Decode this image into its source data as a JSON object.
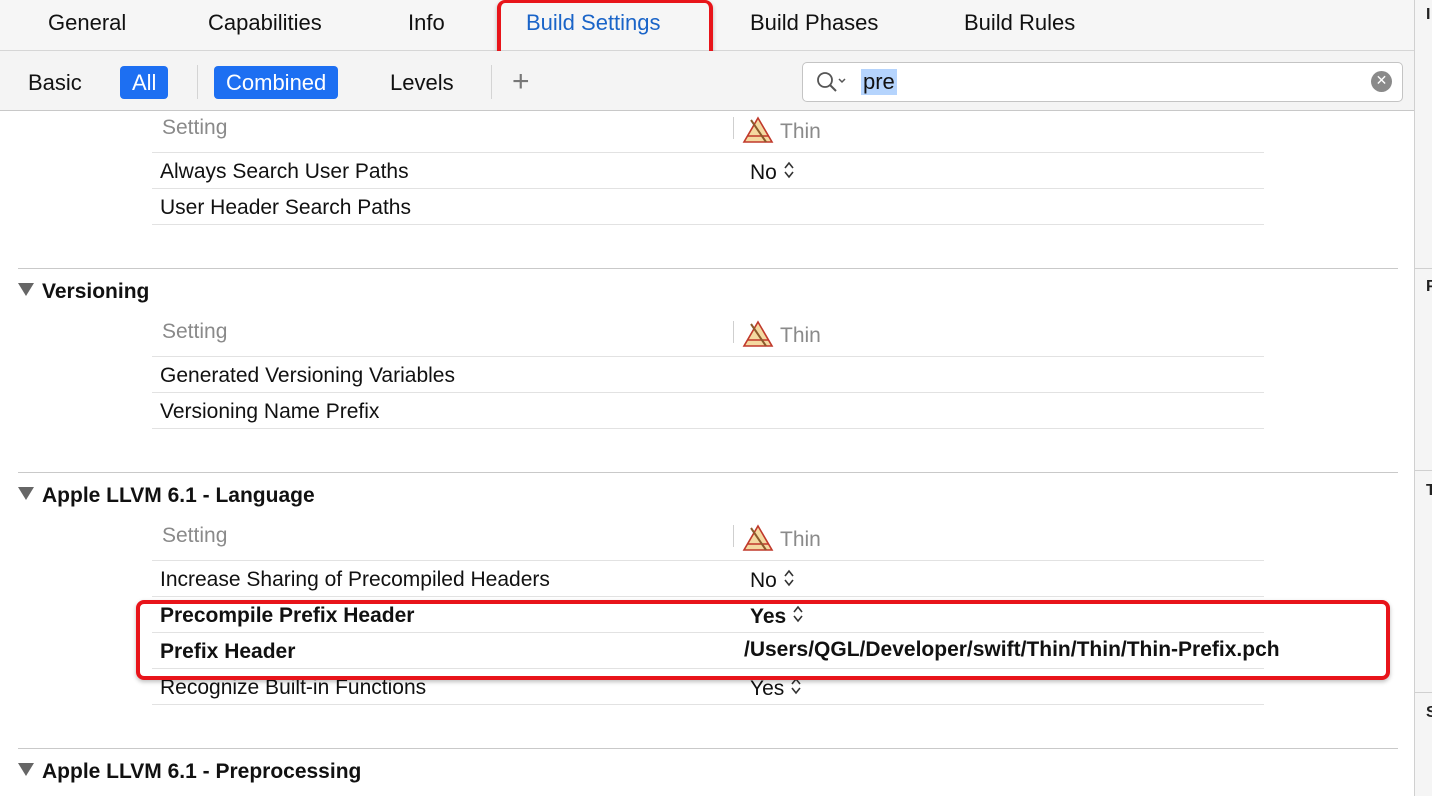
{
  "tabs": {
    "general": "General",
    "capabilities": "Capabilities",
    "info": "Info",
    "build_settings": "Build Settings",
    "build_phases": "Build Phases",
    "build_rules": "Build Rules"
  },
  "filters": {
    "basic": "Basic",
    "all": "All",
    "combined": "Combined",
    "levels": "Levels",
    "add": "+"
  },
  "search": {
    "value": "pre"
  },
  "columns": {
    "setting": "Setting",
    "target": "Thin"
  },
  "sections": {
    "search_paths": {
      "rows": [
        {
          "label": "Always Search User Paths",
          "value": "No"
        },
        {
          "label": "User Header Search Paths",
          "value": ""
        }
      ]
    },
    "versioning": {
      "title": "Versioning",
      "rows": [
        {
          "label": "Generated Versioning Variables",
          "value": ""
        },
        {
          "label": "Versioning Name Prefix",
          "value": ""
        }
      ]
    },
    "llvm_language": {
      "title": "Apple LLVM 6.1 - Language",
      "rows": [
        {
          "label": "Increase Sharing of Precompiled Headers",
          "value": "No"
        },
        {
          "label": "Precompile Prefix Header",
          "value": "Yes"
        },
        {
          "label": "Prefix Header",
          "value": "/Users/QGL/Developer/swift/Thin/Thin/Thin-Prefix.pch"
        },
        {
          "label": "Recognize Built-in Functions",
          "value": "Yes"
        }
      ]
    },
    "llvm_preprocessing": {
      "title": "Apple LLVM 6.1 - Preprocessing"
    }
  },
  "right_pane_letters": [
    "I",
    "P",
    "T",
    "S"
  ],
  "colors": {
    "accent": "#1d6ff2",
    "highlight_box": "#e8141a",
    "active_tab": "#1a64c8"
  }
}
